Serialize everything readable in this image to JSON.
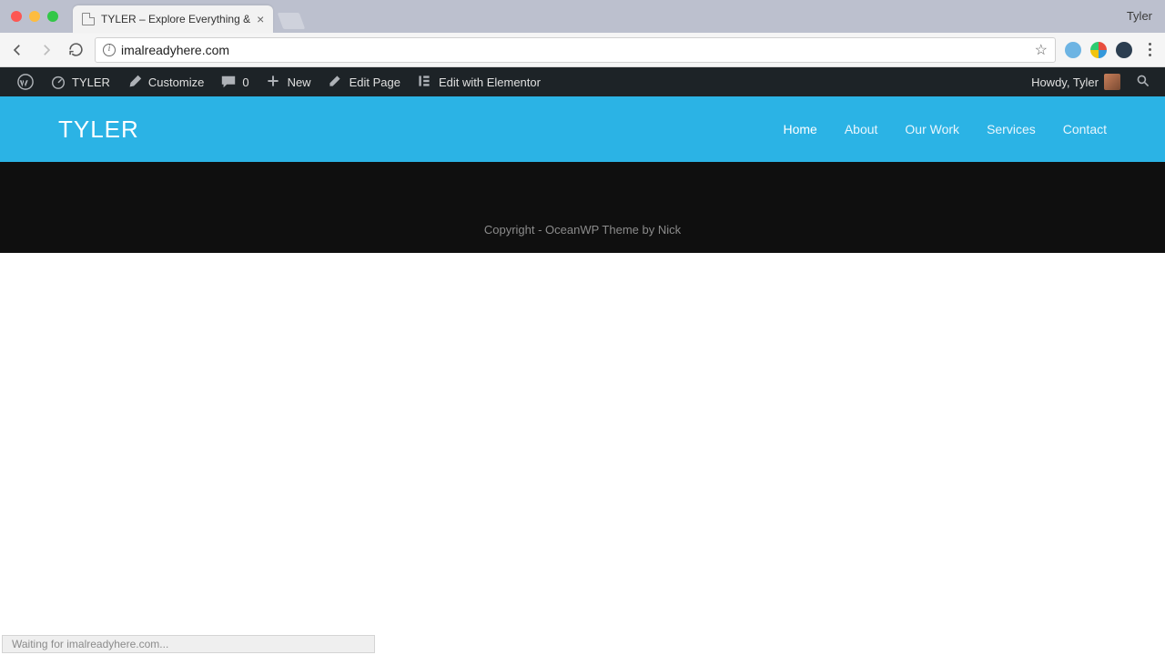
{
  "browser": {
    "profile_name": "Tyler",
    "tab_title": "TYLER – Explore Everything &",
    "url": "imalreadyhere.com",
    "status_text": "Waiting for imalreadyhere.com..."
  },
  "wp_admin_bar": {
    "site_name": "TYLER",
    "customize": "Customize",
    "comments_count": "0",
    "new_label": "New",
    "edit_page": "Edit Page",
    "edit_elementor": "Edit with Elementor",
    "howdy": "Howdy, Tyler"
  },
  "site": {
    "title": "TYLER",
    "nav": [
      {
        "label": "Home",
        "active": true
      },
      {
        "label": "About",
        "active": false
      },
      {
        "label": "Our Work",
        "active": false
      },
      {
        "label": "Services",
        "active": false
      },
      {
        "label": "Contact",
        "active": false
      }
    ],
    "footer_text": "Copyright - OceanWP Theme by Nick"
  },
  "colors": {
    "header_bg": "#2bb3e5",
    "admin_bar_bg": "#1d2327"
  }
}
